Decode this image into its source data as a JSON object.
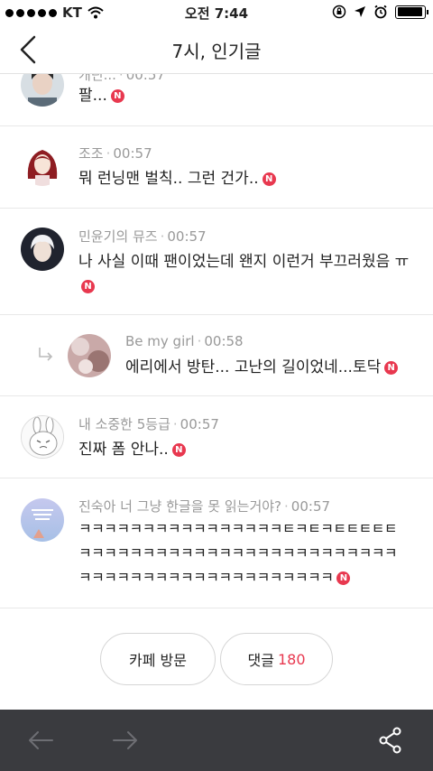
{
  "status_bar": {
    "carrier": "KT",
    "time": "오전 7:44",
    "battery_percent": 95
  },
  "header": {
    "title": "7시, 인기글"
  },
  "comments": [
    {
      "author": "캐틴...",
      "time": "00:57",
      "text": "팔..."
    },
    {
      "author": "조조",
      "time": "00:57",
      "text": "뭐 런닝맨 벌칙.. 그런 건가.."
    },
    {
      "author": "민윤기의 뮤즈",
      "time": "00:57",
      "text": "나 사실 이때 팬이었는데 왠지 이런거 부끄러웠음 ㅠ"
    },
    {
      "author": "Be my girl",
      "time": "00:58",
      "text": "에리에서 방탄... 고난의 길이었네...토닥",
      "is_reply": true
    },
    {
      "author": "내 소중한 5등급",
      "time": "00:57",
      "text": "진짜 폼 안나.."
    },
    {
      "author": "진숙아 너 그냥 한글을 못 읽는거야?",
      "time": "00:57",
      "text_lines": [
        "ㅋㅋㅋㅋㅋㅋㅋㅋㅋㅋㅋㅋㅋㅋㅋㅋㅌㅋㅌㅋㅌㅌㅌㅌㅌ",
        "ㅋㅋㅋㅋㅋㅋㅋㅋㅋㅋㅋㅋㅋㅋㅋㅋㅋㅋㅋㅋㅋㅋㅋㅋㅋ",
        "ㅋㅋㅋㅋㅋㅋㅋㅋㅋㅋㅋㅋㅋㅋㅋㅋㅋㅋㅋㅋ"
      ]
    }
  ],
  "new_badge": "N",
  "buttons": {
    "cafe_visit": "카페 방문",
    "comments_label": "댓글",
    "comments_count": "180"
  },
  "colors": {
    "accent": "#e8384f",
    "toolbar_bg": "#3a3b3f"
  },
  "toolbar": {
    "icons": [
      "back-arrow-icon",
      "forward-arrow-icon",
      "share-icon"
    ]
  }
}
